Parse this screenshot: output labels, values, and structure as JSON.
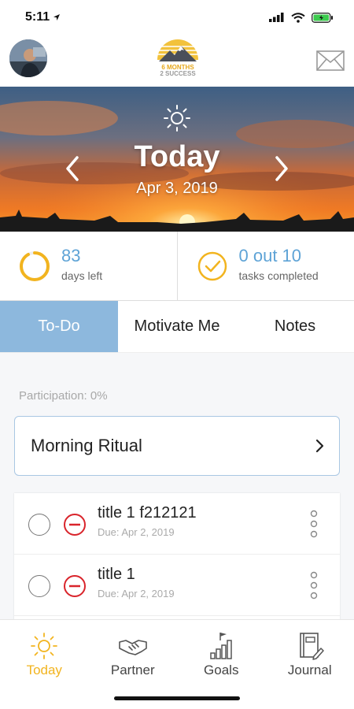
{
  "status_bar": {
    "time": "5:11"
  },
  "header": {
    "logo_line1": "6 MONTHS",
    "logo_line2": "2 SUCCESS"
  },
  "hero": {
    "title": "Today",
    "date": "Apr 3, 2019"
  },
  "stats": {
    "days": {
      "value": "83",
      "label": "days left",
      "progress": 0.92
    },
    "tasks": {
      "value": "0 out 10",
      "label": "tasks completed"
    }
  },
  "tabs": [
    {
      "label": "To-Do"
    },
    {
      "label": "Motivate Me"
    },
    {
      "label": "Notes"
    }
  ],
  "content": {
    "participation": "Participation: 0%",
    "ritual_title": "Morning Ritual",
    "tasks": [
      {
        "title": "title 1 f212121",
        "due": "Due: Apr 2, 2019"
      },
      {
        "title": "title 1",
        "due": "Due: Apr 2, 2019"
      }
    ]
  },
  "nav": [
    {
      "label": "Today"
    },
    {
      "label": "Partner"
    },
    {
      "label": "Goals"
    },
    {
      "label": "Journal"
    }
  ],
  "colors": {
    "accent": "#f2b41f",
    "blue": "#5ea3d6",
    "tab_active": "#8db8dd",
    "danger": "#d9242b"
  }
}
